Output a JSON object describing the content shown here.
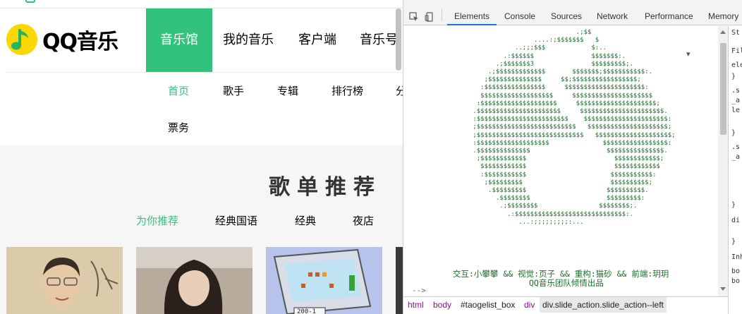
{
  "site": {
    "logo_text": "QQ音乐",
    "main_nav": [
      {
        "label": "音乐馆",
        "active": true
      },
      {
        "label": "我的音乐",
        "active": false
      },
      {
        "label": "客户端",
        "active": false
      },
      {
        "label": "音乐号",
        "active": false
      }
    ],
    "sub_nav": [
      {
        "label": "首页",
        "active": true
      },
      {
        "label": "歌手",
        "active": false
      },
      {
        "label": "专辑",
        "active": false
      },
      {
        "label": "排行榜",
        "active": false
      },
      {
        "label": "分",
        "active": false
      },
      {
        "label": "票务",
        "active": false
      }
    ],
    "section_title": "歌单推荐",
    "category_tabs": [
      {
        "label": "为你推荐",
        "active": true
      },
      {
        "label": "经典国语",
        "active": false
      },
      {
        "label": "经典",
        "active": false
      },
      {
        "label": "夜店",
        "active": false
      }
    ],
    "cards": [
      {
        "name": "playlist-card-man-portrait",
        "bg": "#d9c8a8"
      },
      {
        "name": "playlist-card-woman-portrait",
        "bg": "#b5a89a"
      },
      {
        "name": "playlist-card-game-cartridge",
        "bg": "#b8c4ea",
        "caption": "200-1"
      },
      {
        "name": "playlist-card-dark",
        "bg": "#333333"
      }
    ],
    "accent_color": "#31c27c"
  },
  "devtools": {
    "tabs": [
      {
        "label": "Elements",
        "active": true
      },
      {
        "label": "Console",
        "active": false
      },
      {
        "label": "Sources",
        "active": false
      },
      {
        "label": "Network",
        "active": false
      },
      {
        "label": "Performance",
        "active": false
      },
      {
        "label": "Memory",
        "active": false
      }
    ],
    "ascii_art": "                                   .;$$\n                        ....:;$$$$$$$   $\n                   ..;;;$$$            $:..\n                .:$$$$$$               $$$$$$$:.\n              .;$$$$$$$3               $$$$$$$$$;.\n            .;$$$$$$$$$$$$$       $$$$$$$;$$$$$$$$$$$:.\n           ;$$$$$$$$$$$$$$     $$;$$$$$$$$$$$$$$$$$;\n          :$$$$$$$$$$$$$$$$     $$$$$$$$$$$$$$$$$$$$$:\n          $$$$$$$$$$$$$$$$$$$     $$$$$$$$$$$$$$$$$$$$$\n         :$$$$$$$$$$$$$$$$$$$$     $$$$$$$$$$$$$$$$$$$$$;\n        .$$$$$$$$$$$$$$$$$$$$$$     $$$$$$$$$$$$$$$$$$$$$$.\n        :$$$$$$$$$$$$$$$$$$$$$$$$    $$$$$$$$$$$$$$$$$$$$$$:\n        ;$$$$$$$$$$$$$$$$$$$$$$$$$$   $$$$$$$$$$$$$$$$$$$$$;\n        ;$$$$$$$$$$$$$$$$$$$$$$$$$$$$   $$$$$$$$$$$$$$$$$$$$;\n        :$$$$$$$$$$$$$$$$$$$              $$$$$$$$$$$$$$$$$:\n        .$$$$$$$$$$$$$$                    $$$$$$$$$$$$$$$.\n         ;$$$$$$$$$$$$                       $$$$$$$$$$$$;\n          $$$$$$$$$$$$                       $$$$$$$$$$$$\n          :$$$$$$$$$$$                      $$$$$$$$$$$:\n           ;$$$$$$$$$                       $$$$$$$$$$;\n            .$$$$$$$$$                     $$$$$$$$$$.\n              .$$$$$$$$                    $$$$$$$$$:\n               .;$$$$$$$$                $$$$$$$$;.\n                 .:$$$$$$$$$$$$$$$$$$$$$$$$$$$$$:.\n                    ...:;;;;;;;;;:...",
    "credit_line1": "交互:小攀攀 && 视觉:页子 && 重构:猫砂 && 前端:玥玥",
    "credit_line2": "QQ音乐团队倾情出品",
    "comment_end": "-->",
    "breadcrumb": [
      "html",
      "body",
      "#taogelist_box",
      "div",
      "div.slide_action.slide_action--left"
    ],
    "right_pane": [
      "St",
      "Fil",
      "ele",
      "}",
      ".s",
      "_a",
      "le",
      "}",
      ".s",
      "_a",
      "}",
      "di",
      "}",
      "Inh",
      "bo",
      "bo"
    ]
  }
}
